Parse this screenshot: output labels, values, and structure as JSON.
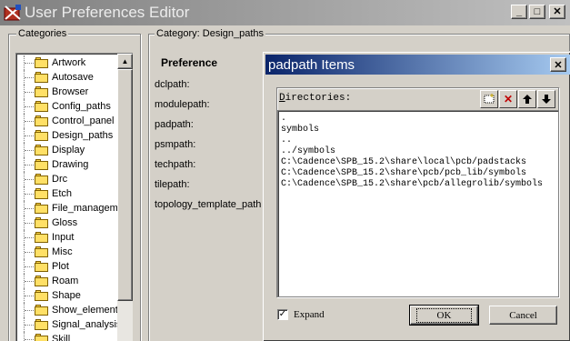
{
  "window": {
    "title": "User Preferences Editor",
    "minimize": "_",
    "maximize": "□",
    "close": "✕"
  },
  "categories": {
    "caption": "Categories",
    "items": [
      "Artwork",
      "Autosave",
      "Browser",
      "Config_paths",
      "Control_panel",
      "Design_paths",
      "Display",
      "Drawing",
      "Drc",
      "Etch",
      "File_managem",
      "Gloss",
      "Input",
      "Misc",
      "Plot",
      "Roam",
      "Shape",
      "Show_element",
      "Signal_analysis",
      "Skill"
    ],
    "scroll_up": "▲"
  },
  "category_panel": {
    "caption": "Category:",
    "value": "Design_paths",
    "header": "Preference",
    "prefs": [
      "dclpath:",
      "modulepath:",
      "padpath:",
      "psmpath:",
      "techpath:",
      "tilepath:",
      "topology_template_path:"
    ]
  },
  "dialog": {
    "title": "padpath Items",
    "close": "✕",
    "dir_label_first": "D",
    "dir_label_rest": "irectories:",
    "tools": {
      "new": "",
      "delete": "✕",
      "up": "🡑",
      "down": "🡓"
    },
    "entries": [
      ".",
      "symbols",
      "..",
      "../symbols",
      "C:\\Cadence\\SPB_15.2\\share\\local\\pcb/padstacks",
      "C:\\Cadence\\SPB_15.2\\share\\pcb/pcb_lib/symbols",
      "C:\\Cadence\\SPB_15.2\\share\\pcb/allegrolib/symbols"
    ],
    "expand_label": "Expand",
    "expand_checked": "✓",
    "ok_label": "OK",
    "cancel_label": "Cancel"
  }
}
